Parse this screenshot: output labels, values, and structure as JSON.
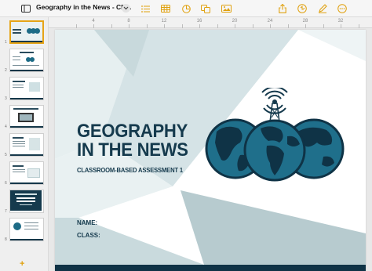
{
  "app": {
    "document_title": "Geography in the News - CB...",
    "toolbar_icons": [
      "sidebar-icon",
      "chevron-down-icon",
      "list-icon",
      "table-icon",
      "chart-icon",
      "shape-icon",
      "media-icon",
      "share-icon",
      "undo-icon",
      "format-icon",
      "more-icon"
    ],
    "accent_color": "#e0a10f"
  },
  "ruler": {
    "labels": [
      "4",
      "8",
      "12",
      "16",
      "20",
      "24",
      "28",
      "32"
    ]
  },
  "navigator": {
    "slides": [
      {
        "number": "1",
        "selected": true
      },
      {
        "number": "2",
        "selected": false
      },
      {
        "number": "3",
        "selected": false
      },
      {
        "number": "4",
        "selected": false
      },
      {
        "number": "5",
        "selected": false
      },
      {
        "number": "6",
        "selected": false
      },
      {
        "number": "7",
        "selected": false
      },
      {
        "number": "8",
        "selected": false
      }
    ],
    "add_label": "+"
  },
  "slide": {
    "title_line1": "GEOGRAPHY",
    "title_line2": "IN THE NEWS",
    "subtitle": "CLASSROOM-BASED ASSESSMENT 1",
    "name_label": "NAME:",
    "class_label": "CLASS:",
    "colors": {
      "navy": "#153a4d",
      "globe": "#1f6f8b",
      "pale_teal": "#dce8ea",
      "mid_teal": "#b8cdd1"
    }
  }
}
